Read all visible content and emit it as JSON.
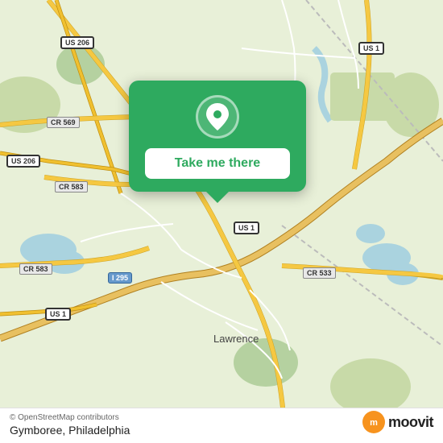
{
  "map": {
    "attribution": "© OpenStreetMap contributors",
    "center": "Gymboree, Philadelphia area",
    "place_name": "Gymboree, Philadelphia"
  },
  "popup": {
    "button_label": "Take me there",
    "icon": "location-pin-icon"
  },
  "branding": {
    "moovit_text": "moovit",
    "moovit_icon": "m"
  },
  "road_labels": [
    {
      "id": "us206-top",
      "text": "US 206",
      "top": "48",
      "left": "80"
    },
    {
      "id": "us1-right",
      "text": "US 1",
      "top": "55",
      "left": "450"
    },
    {
      "id": "cr569",
      "text": "CR 569",
      "top": "148",
      "left": "62"
    },
    {
      "id": "us206-left",
      "text": "US 206",
      "top": "195",
      "left": "10"
    },
    {
      "id": "cr583-top",
      "text": "CR 583",
      "top": "228",
      "left": "72"
    },
    {
      "id": "us1-mid",
      "text": "US 1",
      "top": "278",
      "left": "294"
    },
    {
      "id": "cr583-bot",
      "text": "CR 583",
      "top": "330",
      "left": "28"
    },
    {
      "id": "i295",
      "text": "I 295",
      "top": "340",
      "left": "138"
    },
    {
      "id": "cr533",
      "text": "CR 533",
      "top": "335",
      "left": "380"
    },
    {
      "id": "us1-bot",
      "text": "US 1",
      "top": "385",
      "left": "60"
    },
    {
      "id": "lawrence",
      "text": "Lawrence",
      "top": "415",
      "left": "268"
    }
  ]
}
